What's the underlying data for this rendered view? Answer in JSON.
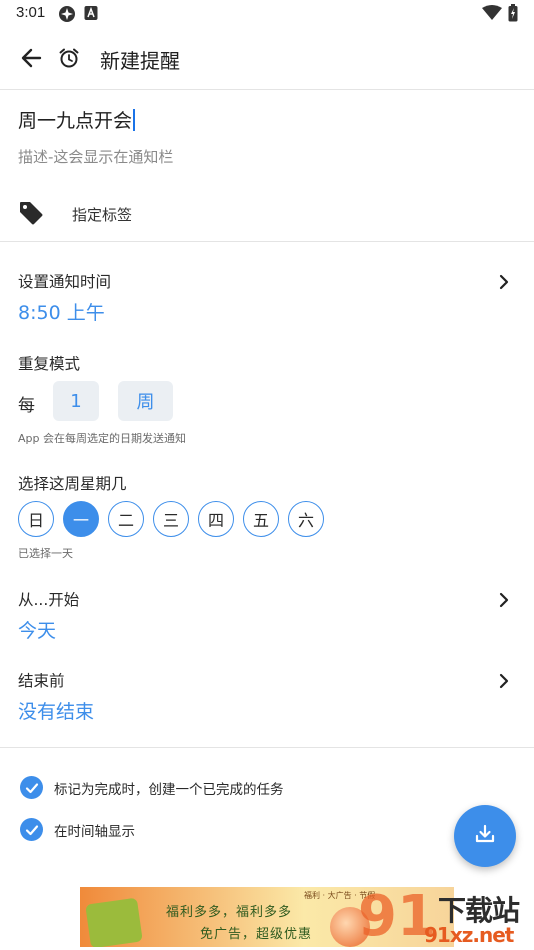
{
  "status_bar": {
    "time": "3:01",
    "icons": [
      "vpn-key-icon",
      "app-notification-icon",
      "wifi-icon",
      "battery-charging-icon"
    ]
  },
  "app_bar": {
    "back_icon": "arrow-back-icon",
    "alarm_icon": "alarm-clock-icon",
    "title": "新建提醒"
  },
  "form": {
    "title_value": "周一九点开会",
    "description_placeholder": "描述-这会显示在通知栏",
    "tag_icon": "tag-icon",
    "tag_label": "指定标签"
  },
  "notify_time": {
    "label": "设置通知时间",
    "value": "8:50 上午"
  },
  "repeat": {
    "label": "重复模式",
    "every_label": "每",
    "interval_value": "1",
    "unit_value": "周",
    "hint": "App 会在每周选定的日期发送通知"
  },
  "weekdays": {
    "label": "选择这周星期几",
    "days": [
      {
        "label": "日",
        "selected": false
      },
      {
        "label": "一",
        "selected": true
      },
      {
        "label": "二",
        "selected": false
      },
      {
        "label": "三",
        "selected": false
      },
      {
        "label": "四",
        "selected": false
      },
      {
        "label": "五",
        "selected": false
      },
      {
        "label": "六",
        "selected": false
      }
    ],
    "hint": "已选择一天"
  },
  "start": {
    "label": "从...开始",
    "value": "今天"
  },
  "end": {
    "label": "结束前",
    "value": "没有结束"
  },
  "options": [
    {
      "label": "标记为完成时，创建一个已完成的任务",
      "checked": true
    },
    {
      "label": "在时间轴显示",
      "checked": true
    }
  ],
  "fab": {
    "icon": "save-download-icon"
  },
  "ad": {
    "top_text": "福利 · 大广告 · 节假",
    "line1": "福利多多，福利多多",
    "line2": "免广告，超级优惠"
  },
  "watermark": {
    "title": "下载站",
    "url": "91xz.net",
    "logo_digits": "91"
  },
  "colors": {
    "accent": "#3d8eea",
    "pill_bg": "#ebeff3",
    "divider": "#e4e4e4",
    "text_primary": "#212121",
    "text_hint": "#8a8a8a"
  }
}
